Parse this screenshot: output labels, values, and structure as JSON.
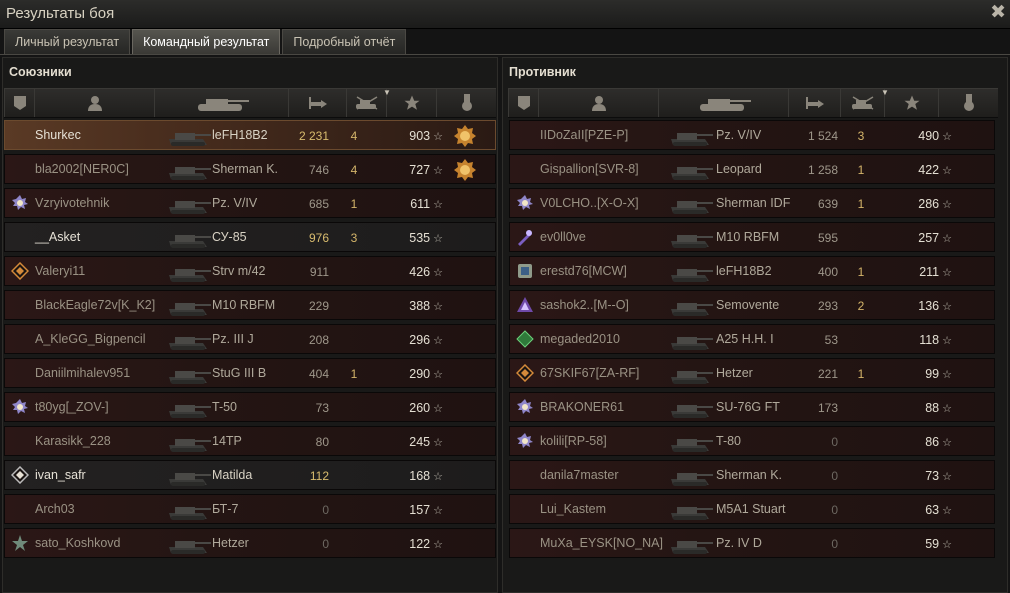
{
  "window": {
    "title": "Результаты боя",
    "close_glyph": "✖"
  },
  "tabs": [
    {
      "label": "Личный результат",
      "active": false
    },
    {
      "label": "Командный результат",
      "active": true
    },
    {
      "label": "Подробный отчёт",
      "active": false
    }
  ],
  "allies": {
    "title": "Союзники",
    "players": [
      {
        "name": "Shurkec",
        "tank": "leFH18B2",
        "damage": "2 231",
        "kills": "4",
        "xp": "903",
        "emblem": "none",
        "medal": "ace-medal",
        "state": "me"
      },
      {
        "name": "bla2002[NER0C]",
        "tank": "Sherman K.",
        "damage": "746",
        "kills": "4",
        "xp": "727",
        "emblem": "none",
        "medal": "ace-medal",
        "state": "dead"
      },
      {
        "name": "Vzryivotehnik",
        "tank": "Pz. V/IV",
        "damage": "685",
        "kills": "1",
        "xp": "611",
        "emblem": "clan-blue",
        "medal": "",
        "state": "dead"
      },
      {
        "name": "__Asket",
        "tank": "СУ-85",
        "damage": "976",
        "kills": "3",
        "xp": "535",
        "emblem": "none",
        "medal": "",
        "state": "alive"
      },
      {
        "name": "Valeryi11",
        "tank": "Strv m/42",
        "damage": "911",
        "kills": "",
        "xp": "426",
        "emblem": "diamond-orange",
        "medal": "",
        "state": "dead"
      },
      {
        "name": "BlackEagle72v[K_K2]",
        "tank": "M10 RBFM",
        "damage": "229",
        "kills": "",
        "xp": "388",
        "emblem": "none",
        "medal": "",
        "state": "dead"
      },
      {
        "name": "A_KleGG_Bigpencil",
        "tank": "Pz. III J",
        "damage": "208",
        "kills": "",
        "xp": "296",
        "emblem": "none",
        "medal": "",
        "state": "dead"
      },
      {
        "name": "Daniilmihalev951",
        "tank": "StuG III B",
        "damage": "404",
        "kills": "1",
        "xp": "290",
        "emblem": "none",
        "medal": "",
        "state": "dead"
      },
      {
        "name": "t80yg[_ZOV-]",
        "tank": "T-50",
        "damage": "73",
        "kills": "",
        "xp": "260",
        "emblem": "clan-blue",
        "medal": "",
        "state": "dead"
      },
      {
        "name": "Karasikk_228",
        "tank": "14TP",
        "damage": "80",
        "kills": "",
        "xp": "245",
        "emblem": "none",
        "medal": "",
        "state": "dead"
      },
      {
        "name": "ivan_safr",
        "tank": "Matilda",
        "damage": "112",
        "kills": "",
        "xp": "168",
        "emblem": "diamond-white",
        "medal": "",
        "state": "alive"
      },
      {
        "name": "Arch03",
        "tank": "БТ-7",
        "damage": "0",
        "kills": "",
        "xp": "157",
        "emblem": "none",
        "medal": "",
        "state": "dead"
      },
      {
        "name": "sato_Koshkovd",
        "tank": "Hetzer",
        "damage": "0",
        "kills": "",
        "xp": "122",
        "emblem": "star-green",
        "medal": "",
        "state": "dead"
      }
    ]
  },
  "enemies": {
    "title": "Противник",
    "players": [
      {
        "name": "IIDoZaII[PZE-P]",
        "tank": "Pz. V/IV",
        "damage": "1 524",
        "kills": "3",
        "xp": "490",
        "emblem": "none",
        "medal": "",
        "state": "dead"
      },
      {
        "name": "Gispallion[SVR-8]",
        "tank": "Leopard",
        "damage": "1 258",
        "kills": "1",
        "xp": "422",
        "emblem": "none",
        "medal": "",
        "state": "dead"
      },
      {
        "name": "V0LCHO..[X-O-X]",
        "tank": "Sherman IDF",
        "damage": "639",
        "kills": "1",
        "xp": "286",
        "emblem": "clan-blue",
        "medal": "",
        "state": "dead"
      },
      {
        "name": "ev0ll0ve",
        "tank": "M10 RBFM",
        "damage": "595",
        "kills": "",
        "xp": "257",
        "emblem": "rocket-purple",
        "medal": "",
        "state": "dead"
      },
      {
        "name": "erestd76[MCW]",
        "tank": "leFH18B2",
        "damage": "400",
        "kills": "1",
        "xp": "211",
        "emblem": "cube-blue",
        "medal": "",
        "state": "dead"
      },
      {
        "name": "sashok2..[M--O]",
        "tank": "Semovente",
        "damage": "293",
        "kills": "2",
        "xp": "136",
        "emblem": "triangle-purple",
        "medal": "",
        "state": "dead"
      },
      {
        "name": "megaded2010",
        "tank": "A25 H.H. I",
        "damage": "53",
        "kills": "",
        "xp": "118",
        "emblem": "diamond-green",
        "medal": "",
        "state": "dead"
      },
      {
        "name": "67SKIF67[ZA-RF]",
        "tank": "Hetzer",
        "damage": "221",
        "kills": "1",
        "xp": "99",
        "emblem": "diamond-orange",
        "medal": "",
        "state": "dead"
      },
      {
        "name": "BRAKONER61",
        "tank": "SU-76G FT",
        "damage": "173",
        "kills": "",
        "xp": "88",
        "emblem": "clan-blue",
        "medal": "",
        "state": "dead"
      },
      {
        "name": "kolili[RP-58]",
        "tank": "T-80",
        "damage": "0",
        "kills": "",
        "xp": "86",
        "emblem": "clan-blue",
        "medal": "",
        "state": "dead"
      },
      {
        "name": "danila7master",
        "tank": "Sherman K.",
        "damage": "0",
        "kills": "",
        "xp": "73",
        "emblem": "none",
        "medal": "",
        "state": "dead"
      },
      {
        "name": "Lui_Kastem",
        "tank": "M5A1 Stuart",
        "damage": "0",
        "kills": "",
        "xp": "63",
        "emblem": "none",
        "medal": "",
        "state": "dead"
      },
      {
        "name": "MuXa_EYSK[NO_NA]",
        "tank": "Pz. IV D",
        "damage": "0",
        "kills": "",
        "xp": "59",
        "emblem": "none",
        "medal": "",
        "state": "dead"
      }
    ]
  },
  "columns": [
    "squad-icon",
    "player-icon",
    "tank-icon",
    "damage-icon",
    "kills-icon",
    "xp-star-icon",
    "medal-icon"
  ],
  "colors": {
    "accent": "#d4b56a",
    "dead_row": "#2b1716",
    "me_row": "#5a3a25"
  }
}
